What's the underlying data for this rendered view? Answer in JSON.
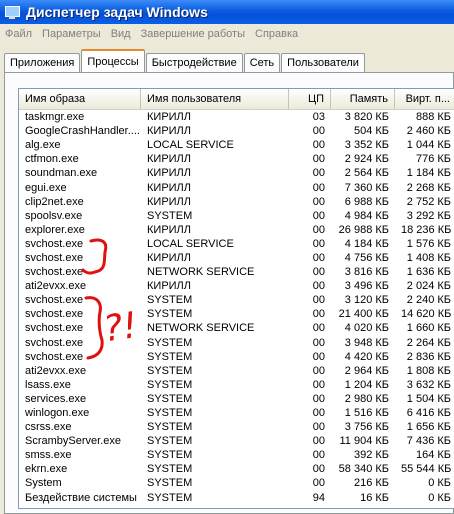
{
  "window": {
    "title": "Диспетчер задач Windows"
  },
  "menu": [
    "Файл",
    "Параметры",
    "Вид",
    "Завершение работы",
    "Справка"
  ],
  "tabs": [
    {
      "label": "Приложения",
      "active": false
    },
    {
      "label": "Процессы",
      "active": true
    },
    {
      "label": "Быстродействие",
      "active": false
    },
    {
      "label": "Сеть",
      "active": false
    },
    {
      "label": "Пользователи",
      "active": false
    }
  ],
  "columns": [
    "Имя образа",
    "Имя пользователя",
    "ЦП",
    "Память",
    "Вирт. п..."
  ],
  "rows": [
    [
      "taskmgr.exe",
      "КИРИЛЛ",
      "03",
      "3 820 КБ",
      "888 КБ"
    ],
    [
      "GoogleCrashHandler....",
      "КИРИЛЛ",
      "00",
      "504 КБ",
      "2 460 КБ"
    ],
    [
      "alg.exe",
      "LOCAL SERVICE",
      "00",
      "3 352 КБ",
      "1 044 КБ"
    ],
    [
      "ctfmon.exe",
      "КИРИЛЛ",
      "00",
      "2 924 КБ",
      "776 КБ"
    ],
    [
      "soundman.exe",
      "КИРИЛЛ",
      "00",
      "2 564 КБ",
      "1 184 КБ"
    ],
    [
      "egui.exe",
      "КИРИЛЛ",
      "00",
      "7 360 КБ",
      "2 268 КБ"
    ],
    [
      "clip2net.exe",
      "КИРИЛЛ",
      "00",
      "6 988 КБ",
      "2 752 КБ"
    ],
    [
      "spoolsv.exe",
      "SYSTEM",
      "00",
      "4 984 КБ",
      "3 292 КБ"
    ],
    [
      "explorer.exe",
      "КИРИЛЛ",
      "00",
      "26 988 КБ",
      "18 236 КБ"
    ],
    [
      "svchost.exe",
      "LOCAL SERVICE",
      "00",
      "4 184 КБ",
      "1 576 КБ"
    ],
    [
      "svchost.exe",
      "КИРИЛЛ",
      "00",
      "4 756 КБ",
      "1 408 КБ"
    ],
    [
      "svchost.exe",
      "NETWORK SERVICE",
      "00",
      "3 816 КБ",
      "1 636 КБ"
    ],
    [
      "ati2evxx.exe",
      "КИРИЛЛ",
      "00",
      "3 496 КБ",
      "2 024 КБ"
    ],
    [
      "svchost.exe",
      "SYSTEM",
      "00",
      "3 120 КБ",
      "2 240 КБ"
    ],
    [
      "svchost.exe",
      "SYSTEM",
      "00",
      "21 400 КБ",
      "14 620 КБ"
    ],
    [
      "svchost.exe",
      "NETWORK SERVICE",
      "00",
      "4 020 КБ",
      "1 660 КБ"
    ],
    [
      "svchost.exe",
      "SYSTEM",
      "00",
      "3 948 КБ",
      "2 264 КБ"
    ],
    [
      "svchost.exe",
      "SYSTEM",
      "00",
      "4 420 КБ",
      "2 836 КБ"
    ],
    [
      "ati2evxx.exe",
      "SYSTEM",
      "00",
      "2 964 КБ",
      "1 808 КБ"
    ],
    [
      "lsass.exe",
      "SYSTEM",
      "00",
      "1 204 КБ",
      "3 632 КБ"
    ],
    [
      "services.exe",
      "SYSTEM",
      "00",
      "2 980 КБ",
      "1 504 КБ"
    ],
    [
      "winlogon.exe",
      "SYSTEM",
      "00",
      "1 516 КБ",
      "6 416 КБ"
    ],
    [
      "csrss.exe",
      "SYSTEM",
      "00",
      "3 756 КБ",
      "1 656 КБ"
    ],
    [
      "ScrambyServer.exe",
      "SYSTEM",
      "00",
      "11 904 КБ",
      "7 436 КБ"
    ],
    [
      "smss.exe",
      "SYSTEM",
      "00",
      "392 КБ",
      "164 КБ"
    ],
    [
      "ekrn.exe",
      "SYSTEM",
      "00",
      "58 340 КБ",
      "55 544 КБ"
    ],
    [
      "System",
      "SYSTEM",
      "00",
      "216 КБ",
      "0 КБ"
    ],
    [
      "Бездействие системы",
      "SYSTEM",
      "94",
      "16 КБ",
      "0 КБ"
    ]
  ],
  "annotation": {
    "marks": "?!",
    "color": "#e01010"
  }
}
